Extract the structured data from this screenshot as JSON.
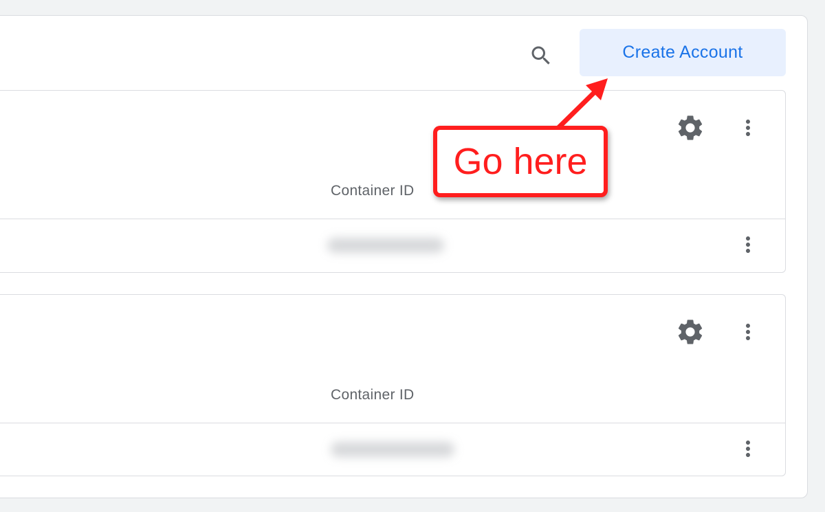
{
  "toolbar": {
    "search_icon": "search-icon",
    "create_account_label": "Create Account"
  },
  "accounts": [
    {
      "column_label": "Container ID",
      "settings_icon": "gear-icon",
      "more_icon": "more-vert-icon",
      "row_more_icon": "more-vert-icon"
    },
    {
      "column_label": "Container ID",
      "settings_icon": "gear-icon",
      "more_icon": "more-vert-icon",
      "row_more_icon": "more-vert-icon"
    }
  ],
  "annotation": {
    "text": "Go here",
    "color": "#ff1e1e"
  },
  "colors": {
    "accent": "#1a73e8",
    "button_bg": "#e8f0fe",
    "icon": "#5f6368",
    "border": "#dadce0",
    "page_bg": "#f1f3f4"
  }
}
